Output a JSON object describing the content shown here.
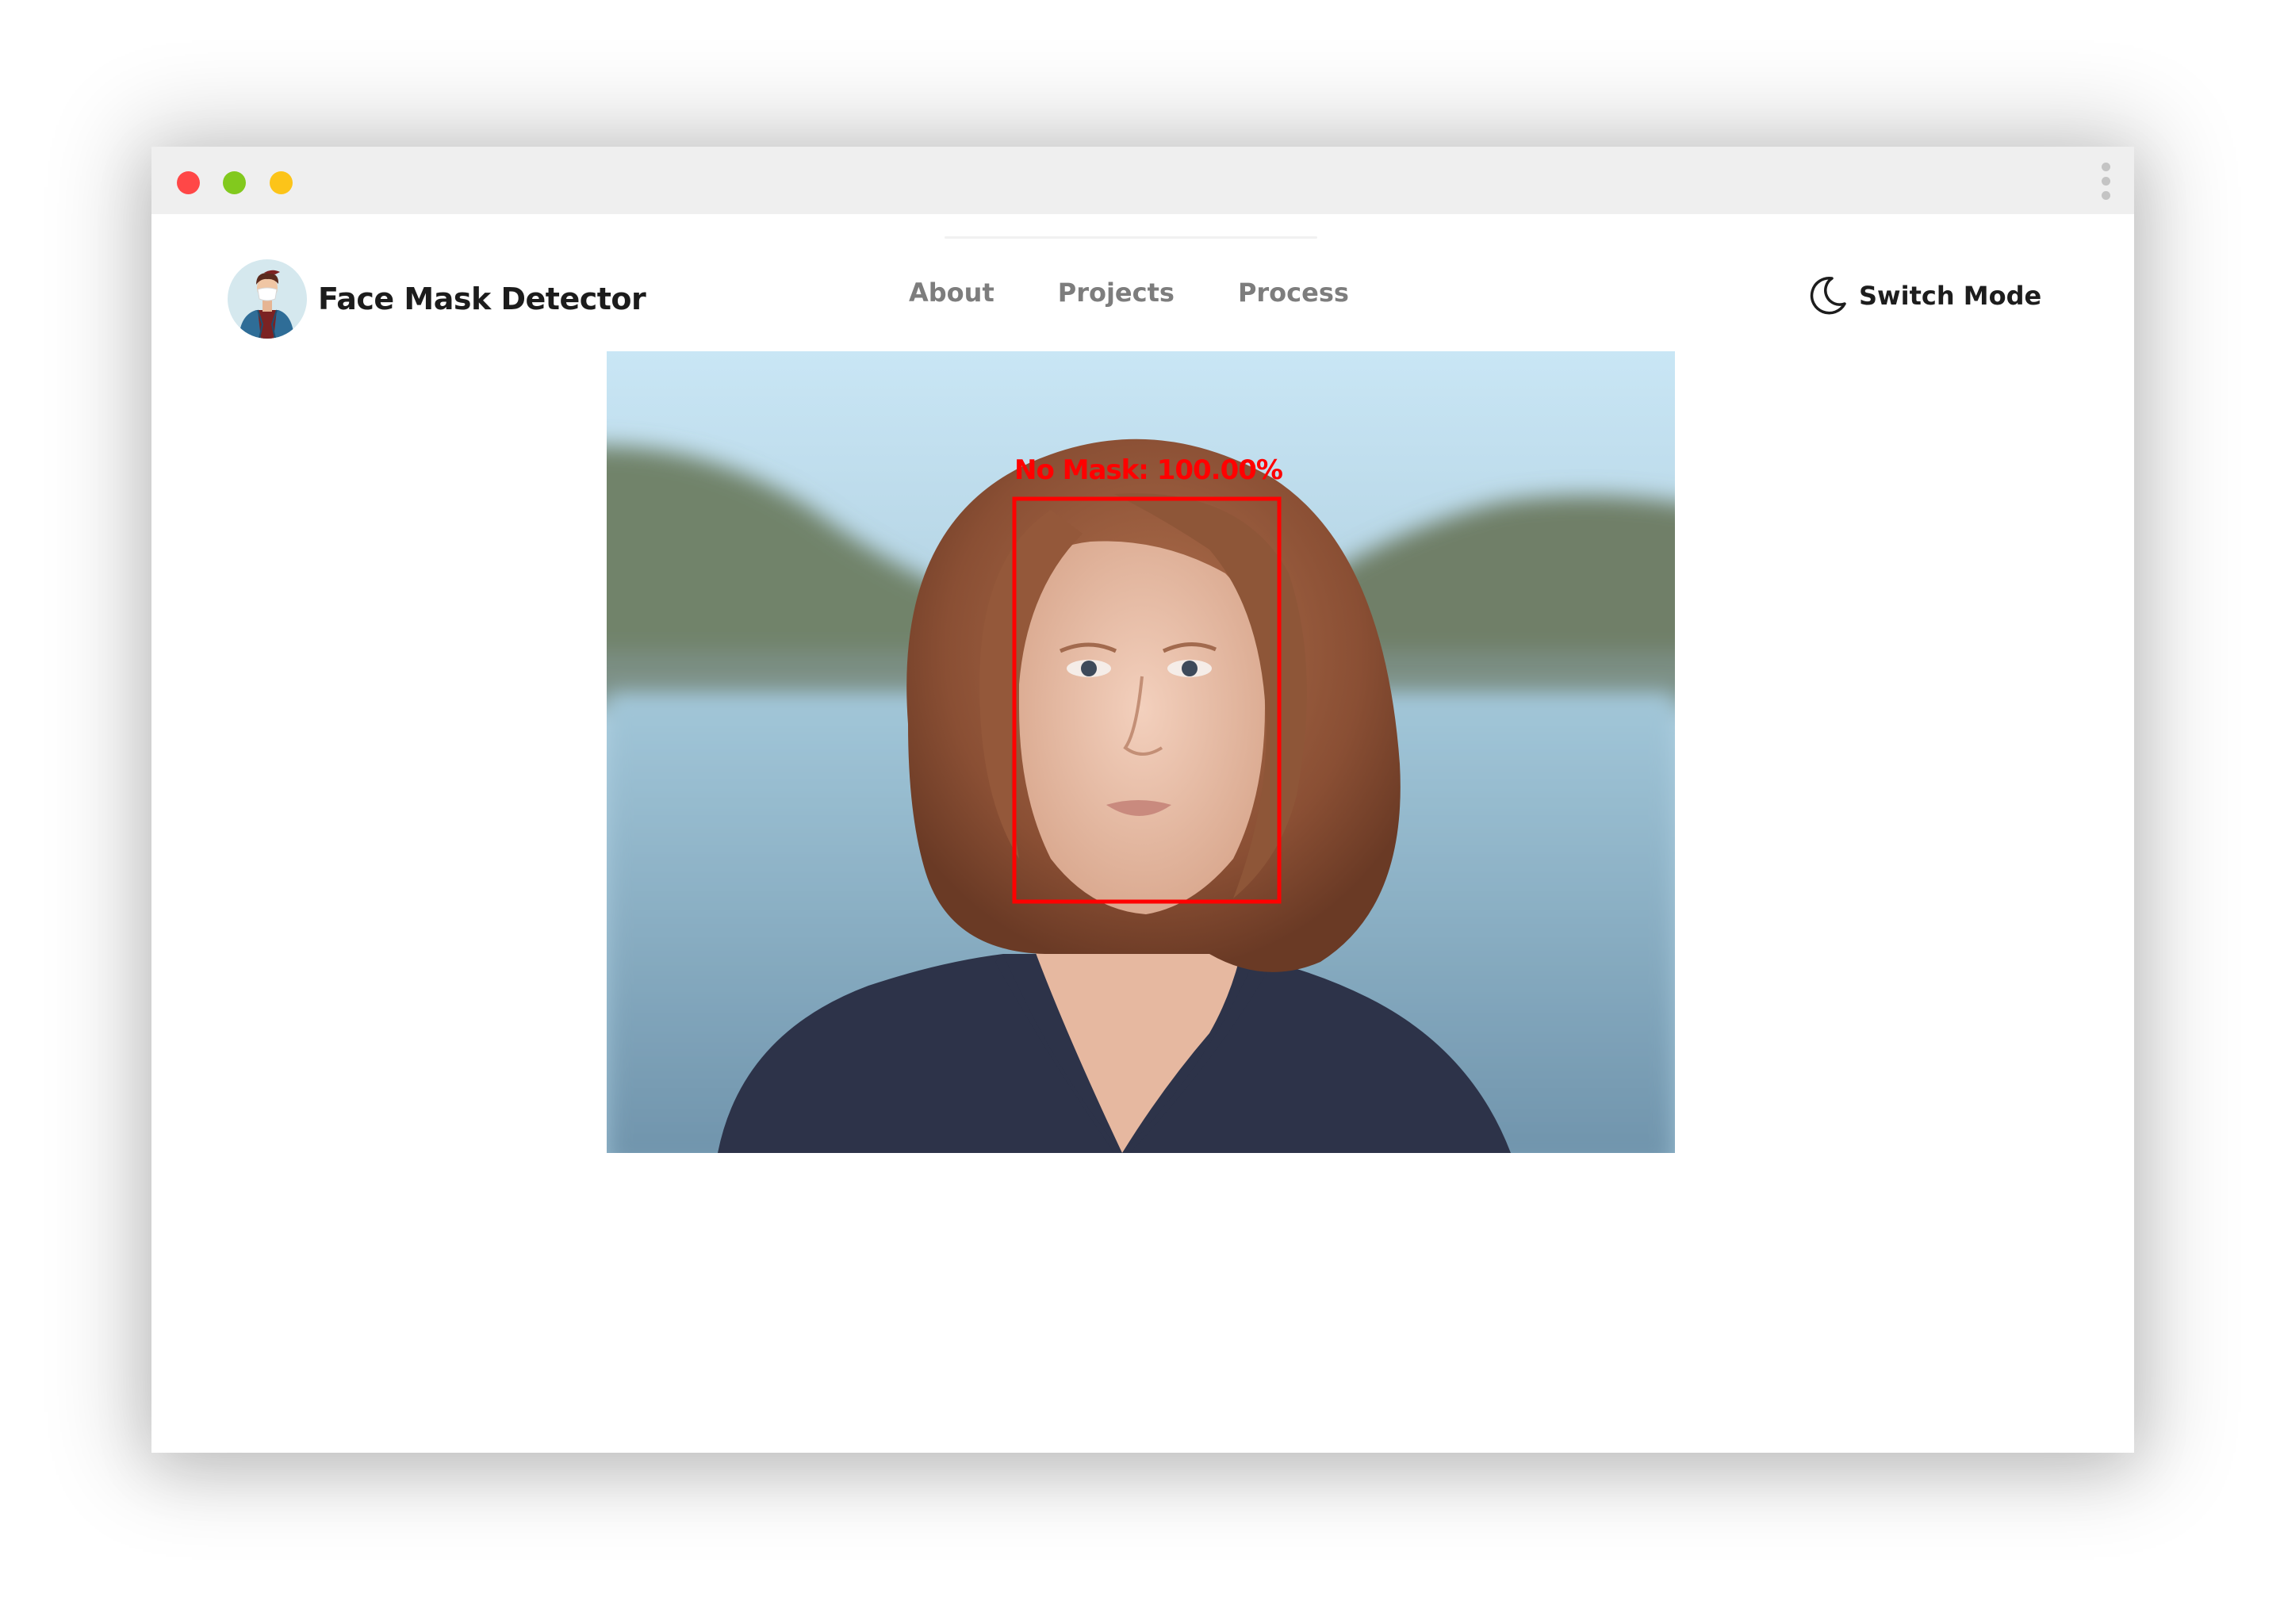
{
  "window": {
    "controls": {
      "close_color": "#ff4747",
      "minimize_color": "#82c91e",
      "maximize_color": "#fcc419",
      "menu_icon": "kebab-menu-icon"
    }
  },
  "header": {
    "brand": {
      "name": "Face Mask Detector",
      "logo_icon": "masked-person-avatar-icon"
    },
    "nav": {
      "items": [
        {
          "label": "About"
        },
        {
          "label": "Projects"
        },
        {
          "label": "Process"
        }
      ]
    },
    "switch_mode": {
      "label": "Switch Mode",
      "icon": "moon-icon"
    }
  },
  "main": {
    "image": {
      "subject": "portrait-photo",
      "detection": {
        "label": "No Mask: 100.00%",
        "box_color": "#ff0000"
      }
    }
  }
}
